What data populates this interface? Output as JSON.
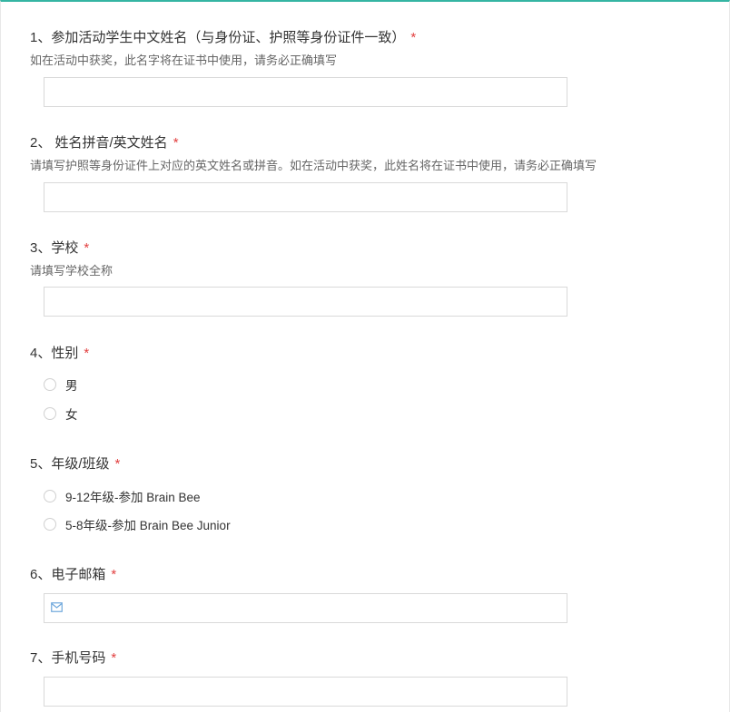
{
  "questions": [
    {
      "title": "1、参加活动学生中文姓名（与身份证、护照等身份证件一致）",
      "required": "*",
      "desc": "如在活动中获奖，此名字将在证书中使用，请务必正确填写"
    },
    {
      "title": "2、 姓名拼音/英文姓名",
      "required": "*",
      "desc": "请填写护照等身份证件上对应的英文姓名或拼音。如在活动中获奖，此姓名将在证书中使用，请务必正确填写"
    },
    {
      "title": "3、学校",
      "required": "*",
      "desc": "请填写学校全称"
    },
    {
      "title": "4、性别",
      "required": "*",
      "options": [
        "男",
        "女"
      ]
    },
    {
      "title": "5、年级/班级",
      "required": "*",
      "options": [
        "9-12年级-参加 Brain Bee",
        "5-8年级-参加 Brain Bee Junior"
      ]
    },
    {
      "title": "6、电子邮箱",
      "required": "*",
      "icon": "mail-icon"
    },
    {
      "title": "7、手机号码",
      "required": "*"
    }
  ],
  "colors": {
    "accent": "#35b5a3",
    "required": "#e23f3f",
    "icon": "#6fa8dc"
  }
}
